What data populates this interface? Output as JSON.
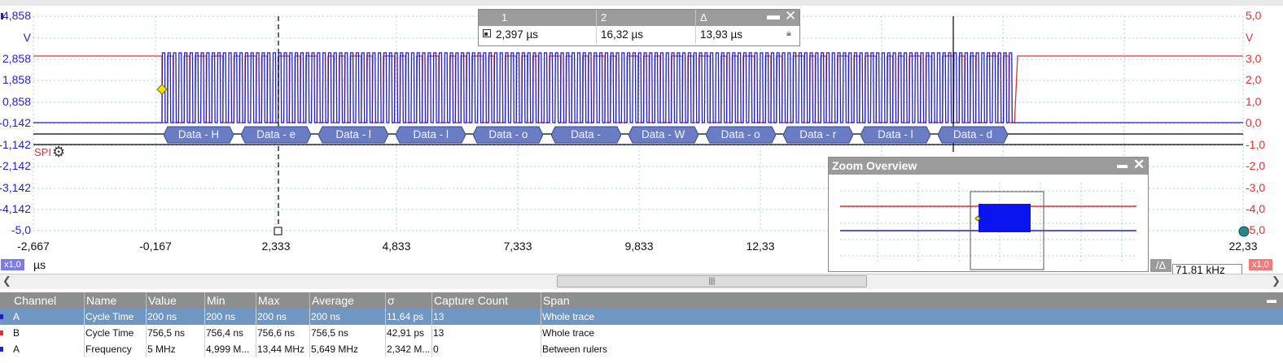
{
  "colors": {
    "channel_a": "#1f1fd1",
    "channel_b": "#e23030",
    "selected_row": "#6f97c1",
    "decode_fill": "#6a7cc4"
  },
  "y_axis_left": {
    "labels": [
      "4,858",
      "V",
      "2,858",
      "1,858",
      "0,858",
      "-0,142",
      "-1,142",
      "-2,142",
      "-3,142",
      "-4,142",
      "-5,0"
    ]
  },
  "y_axis_right": {
    "labels": [
      "5,0",
      "V",
      "3,0",
      "2,0",
      "1,0",
      "0,0",
      "-1,0",
      "-2,0",
      "-3,0",
      "-4,0",
      "-5,0"
    ]
  },
  "x_axis": {
    "labels": [
      "-2,667",
      "-0,167",
      "2,333",
      "4,833",
      "7,333",
      "9,833",
      "12,33",
      "22,33"
    ],
    "unit": "µs",
    "zoom_left": "x1,0",
    "zoom_right": "x1,0"
  },
  "spi": {
    "label": "SPI",
    "icon": "gear-icon"
  },
  "decode": [
    "Data - H",
    "Data - e",
    "Data - l",
    "Data - l",
    "Data - o",
    "Data - ",
    "Data - W",
    "Data - o",
    "Data - r",
    "Data - l",
    "Data - d"
  ],
  "rulers": {
    "headers": [
      "1",
      "2",
      "Δ"
    ],
    "values": [
      "2,397 µs",
      "16,32 µs",
      "13,93 µs"
    ]
  },
  "zoom_overview": {
    "title": "Zoom Overview"
  },
  "frequency": {
    "prefix": "/Δ",
    "value": "71,81 kHz"
  },
  "measurements": {
    "columns": [
      "Channel",
      "Name",
      "Value",
      "Min",
      "Max",
      "Average",
      "σ",
      "Capture Count",
      "Span"
    ],
    "rows": [
      {
        "cells": [
          "A",
          "Cycle Time",
          "200 ns",
          "200 ns",
          "200 ns",
          "200 ns",
          "11,64 ps",
          "13",
          "Whole trace"
        ],
        "color": "#1f1fd1",
        "selected": true
      },
      {
        "cells": [
          "B",
          "Cycle Time",
          "756,5 ns",
          "756,4 ns",
          "756,6 ns",
          "756,5 ns",
          "42,91 ps",
          "13",
          "Whole trace"
        ],
        "color": "#e23030",
        "selected": false
      },
      {
        "cells": [
          "A",
          "Frequency",
          "5 MHz",
          "4,999 M...",
          "13,44 MHz",
          "5,649 MHz",
          "2,342 M...",
          "0",
          "Between rulers"
        ],
        "color": "#1f1fd1",
        "selected": false
      }
    ]
  }
}
